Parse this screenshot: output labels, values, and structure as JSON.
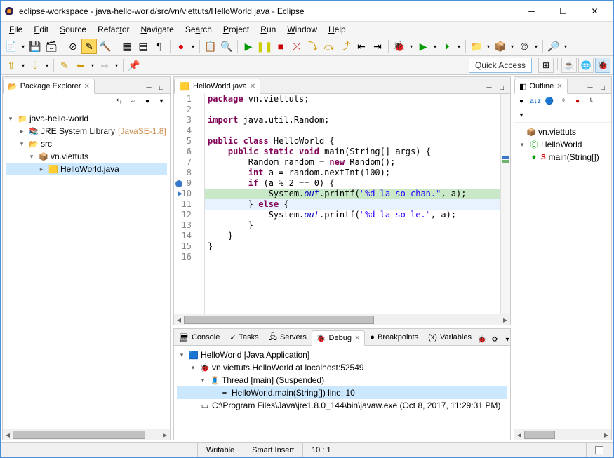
{
  "window": {
    "title": "eclipse-workspace - java-hello-world/src/vn/viettuts/HelloWorld.java - Eclipse"
  },
  "menubar": [
    {
      "label": "File",
      "u": "F"
    },
    {
      "label": "Edit",
      "u": "E"
    },
    {
      "label": "Source",
      "u": "S"
    },
    {
      "label": "Refactor",
      "u": "t"
    },
    {
      "label": "Navigate",
      "u": "N"
    },
    {
      "label": "Search",
      "u": "a"
    },
    {
      "label": "Project",
      "u": "P"
    },
    {
      "label": "Run",
      "u": "R"
    },
    {
      "label": "Window",
      "u": "W"
    },
    {
      "label": "Help",
      "u": "H"
    }
  ],
  "quick_access": "Quick Access",
  "package_explorer": {
    "title": "Package Explorer",
    "tree": {
      "project": "java-hello-world",
      "jre": "JRE System Library",
      "jre_ver": "[JavaSE-1.8]",
      "src": "src",
      "pkg": "vn.viettuts",
      "file": "HelloWorld.java"
    }
  },
  "editor": {
    "tab": "HelloWorld.java",
    "lines": [
      {
        "n": 1,
        "html": "<span class='kw'>package</span> vn.viettuts;"
      },
      {
        "n": 2,
        "html": ""
      },
      {
        "n": 3,
        "html": "<span class='kw'>import</span> java.util.Random;"
      },
      {
        "n": 4,
        "html": ""
      },
      {
        "n": 5,
        "html": "<span class='kw'>public class</span> HelloWorld {"
      },
      {
        "n": 6,
        "html": "    <span class='kw'>public static void</span> main(String[] args) {",
        "fold": true
      },
      {
        "n": 7,
        "html": "        Random random = <span class='kw'>new</span> Random();"
      },
      {
        "n": 8,
        "html": "        <span class='kw'>int</span> a = random.nextInt(100);"
      },
      {
        "n": 9,
        "html": "        <span class='kw'>if</span> (a % 2 == 0) {",
        "mark": "bp"
      },
      {
        "n": 10,
        "html": "            System.<span class='fld'>out</span>.printf(<span class='str'>\"%d la so chan.\"</span>, a);",
        "highlight": true,
        "mark": "arrow"
      },
      {
        "n": 11,
        "html": "        } <span class='kw'>else</span> {",
        "current": true
      },
      {
        "n": 12,
        "html": "            System.<span class='fld'>out</span>.printf(<span class='str'>\"%d la so le.\"</span>, a);"
      },
      {
        "n": 13,
        "html": "        }"
      },
      {
        "n": 14,
        "html": "    }"
      },
      {
        "n": 15,
        "html": "}"
      },
      {
        "n": 16,
        "html": ""
      }
    ]
  },
  "outline": {
    "title": "Outline",
    "pkg": "vn.viettuts",
    "class": "HelloWorld",
    "method": "main(String[])",
    "method_marker": "S"
  },
  "bottom": {
    "tabs": [
      "Console",
      "Tasks",
      "Servers",
      "Debug",
      "Breakpoints",
      "Variables"
    ],
    "active": 3,
    "debug_tree": {
      "app": "HelloWorld [Java Application]",
      "proc": "vn.viettuts.HelloWorld at localhost:52549",
      "thread": "Thread [main] (Suspended)",
      "frame": "HelloWorld.main(String[]) line: 10",
      "vm": "C:\\Program Files\\Java\\jre1.8.0_144\\bin\\javaw.exe (Oct 8, 2017, 11:29:31 PM)"
    }
  },
  "statusbar": {
    "writable": "Writable",
    "insert": "Smart Insert",
    "pos": "10 : 1"
  }
}
